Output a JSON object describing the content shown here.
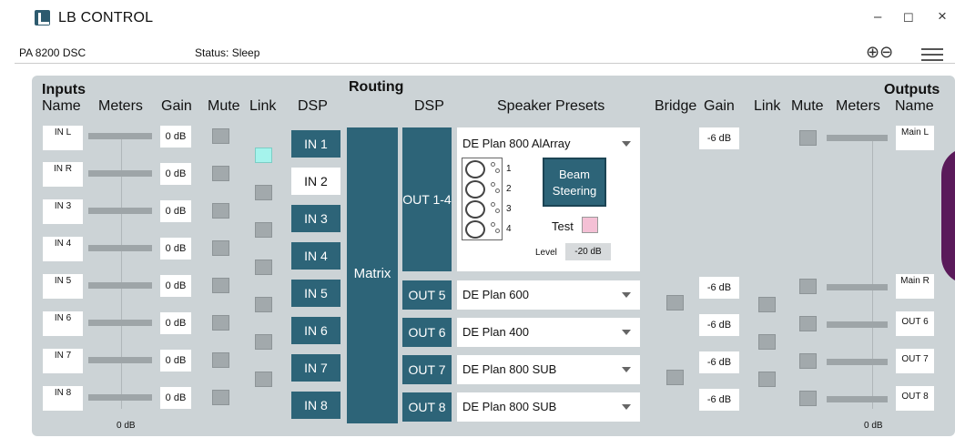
{
  "window": {
    "title": "LB CONTROL",
    "minimize": "–",
    "maximize": "☐",
    "close": "×"
  },
  "subbar": {
    "model": "PA 8200 DSC",
    "status": "Status: Sleep",
    "zoom": "⊕⊖"
  },
  "headers": {
    "inputs": "Inputs",
    "name": "Name",
    "meters": "Meters",
    "gain": "Gain",
    "mute": "Mute",
    "link": "Link",
    "dsp": "DSP",
    "routing": "Routing",
    "speaker_presets": "Speaker Presets",
    "bridge": "Bridge",
    "outputs": "Outputs",
    "matrix": "Matrix"
  },
  "inputs": [
    {
      "name": "IN L",
      "gain": "0 dB",
      "dsp": "IN 1"
    },
    {
      "name": "IN R",
      "gain": "0 dB",
      "dsp": "IN 2"
    },
    {
      "name": "IN 3",
      "gain": "0 dB",
      "dsp": "IN 3"
    },
    {
      "name": "IN 4",
      "gain": "0 dB",
      "dsp": "IN 4"
    },
    {
      "name": "IN 5",
      "gain": "0 dB",
      "dsp": "IN 5"
    },
    {
      "name": "IN 6",
      "gain": "0 dB",
      "dsp": "IN 6"
    },
    {
      "name": "IN 7",
      "gain": "0 dB",
      "dsp": "IN 7"
    },
    {
      "name": "IN 8",
      "gain": "0 dB",
      "dsp": "IN 8"
    }
  ],
  "input_meter_scale": "0 dB",
  "output_meter_scale": "0 dB",
  "outputs": [
    {
      "dsp": "OUT 1-4",
      "preset": "DE Plan 800 AlArray",
      "gain": "-6 dB",
      "name": "Main L"
    },
    {
      "dsp": "OUT 5",
      "preset": "DE Plan 600",
      "gain": "-6 dB",
      "name": "Main R"
    },
    {
      "dsp": "OUT 6",
      "preset": "DE Plan 400",
      "gain": "-6 dB",
      "name": "OUT 6"
    },
    {
      "dsp": "OUT 7",
      "preset": "DE Plan 800 SUB",
      "gain": "-6 dB",
      "name": "OUT 7"
    },
    {
      "dsp": "OUT 8",
      "preset": "DE Plan 800 SUB",
      "gain": "-6 dB",
      "name": "OUT 8"
    }
  ],
  "array": {
    "speaker_numbers": [
      "1",
      "2",
      "3",
      "4"
    ],
    "beam_line1": "Beam",
    "beam_line2": "Steering",
    "test_label": "Test",
    "level_label": "Level",
    "level_value": "-20  dB"
  },
  "colors": {
    "dsp_blue": "#2d6478",
    "panel": "#ccd3d6",
    "link_active": "#a5f3ec",
    "test_pink": "#f4c0d5"
  }
}
